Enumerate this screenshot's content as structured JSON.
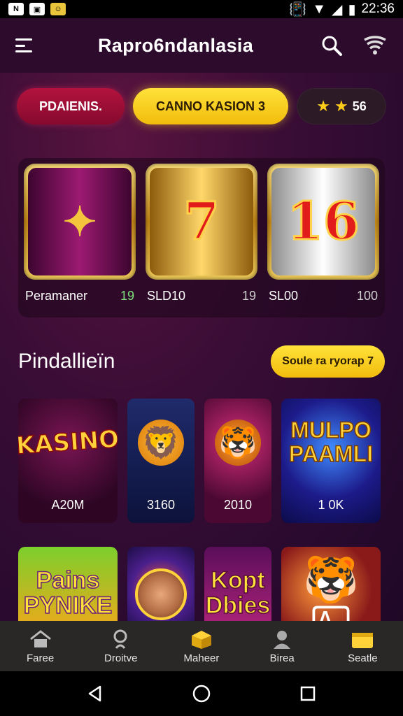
{
  "status_bar": {
    "time": "22:36"
  },
  "header": {
    "title": "Rapro6ndanlasia"
  },
  "chips": [
    {
      "label": "PDAIENIS."
    },
    {
      "label": "CANNO KASION 3"
    },
    {
      "label": "56"
    }
  ],
  "featured": {
    "slots": [
      {
        "name": "Peramaner",
        "value": "19",
        "symbol": "✦"
      },
      {
        "name": "SLD10",
        "value": "19",
        "symbol": "7"
      },
      {
        "name": "SL00",
        "value": "100",
        "symbol": "16"
      }
    ]
  },
  "section": {
    "title": "Pindallieїn",
    "see_all": "Soule ra ryorap 7"
  },
  "games_row1": [
    {
      "art": "KASINO",
      "label": "A20M"
    },
    {
      "art": "lion",
      "label": "3160"
    },
    {
      "art": "tiger",
      "label": "2010"
    },
    {
      "art": "MULPO PAAMLI",
      "label": "1 0K"
    }
  ],
  "games_row2": [
    {
      "art": "Pains PYNIKE"
    },
    {
      "art": "roulette"
    },
    {
      "art": "Kopt Dbies"
    },
    {
      "art": "tiger cards"
    }
  ],
  "bottom_nav": [
    {
      "label": "Faree",
      "icon": "home-icon"
    },
    {
      "label": "Droitve",
      "icon": "search-person-icon"
    },
    {
      "label": "Maheer",
      "icon": "box-icon"
    },
    {
      "label": "Birea",
      "icon": "user-icon"
    },
    {
      "label": "Seatle",
      "icon": "wallet-icon"
    }
  ],
  "colors": {
    "accent": "#f1bc0b",
    "chip_red": "#b3133e",
    "bg": "#2a0a2f"
  }
}
